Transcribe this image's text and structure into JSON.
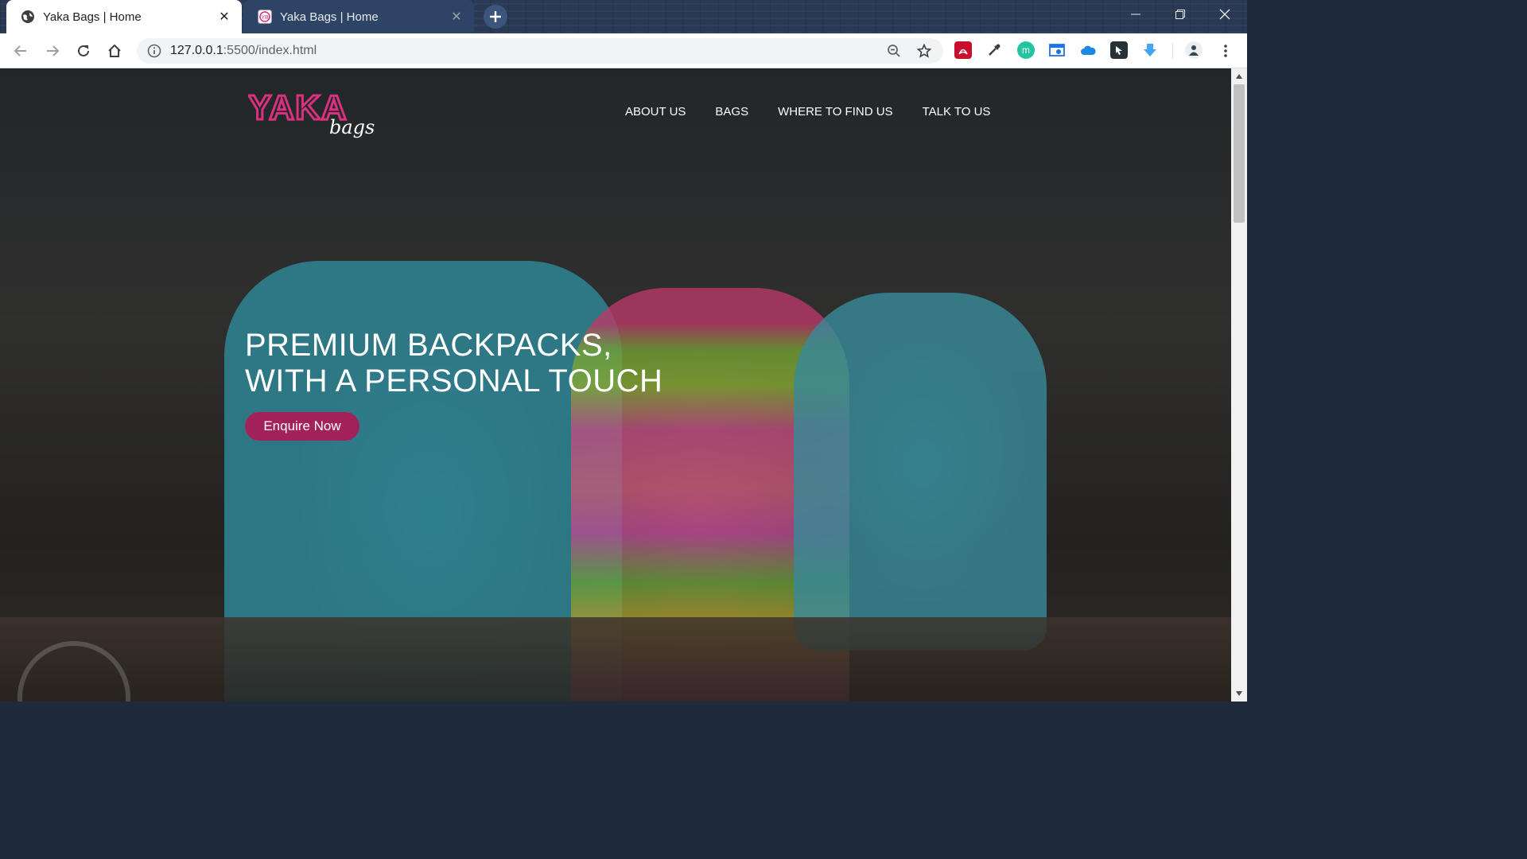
{
  "browser": {
    "tabs": [
      {
        "title": "Yaka Bags | Home",
        "active": true,
        "favicon": "globe-icon"
      },
      {
        "title": "Yaka Bags | Home",
        "active": false,
        "favicon": "yaka-favicon-icon"
      }
    ],
    "new_tab_icon": "plus-icon",
    "window_controls": [
      "minimize-icon",
      "restore-icon",
      "close-icon"
    ],
    "address_bar": {
      "url_host": "127.0.0.1",
      "url_path": ":5500/index.html",
      "info_icon": "info-icon"
    },
    "toolbar_icons": [
      "back-icon",
      "forward-icon",
      "reload-icon",
      "home-icon",
      "zoom-icon",
      "star-icon",
      "menu-dots-icon"
    ],
    "extensions": [
      "pdf-extension-icon",
      "eyedropper-extension-icon",
      "green-circle-extension-icon",
      "screenshot-extension-icon",
      "cloud-extension-icon",
      "dark-cursor-extension-icon",
      "download-arrow-extension-icon",
      "profile-avatar-icon"
    ],
    "colors": {
      "titlebar": "#2a3a55",
      "tab_active": "#ffffff",
      "tab_inactive": "#2e4466"
    }
  },
  "page": {
    "logo": {
      "primary": "YAKA",
      "secondary": "bags",
      "color": "#d9307f"
    },
    "nav": {
      "items": [
        "ABOUT US",
        "BAGS",
        "WHERE TO FIND US",
        "TALK TO US"
      ]
    },
    "hero": {
      "line1": "PREMIUM BACKPACKS,",
      "line2": "WITH A PERSONAL TOUCH",
      "cta": "Enquire Now",
      "cta_color": "#a3215b",
      "background_description_hidden": true
    }
  },
  "scrollbar": {
    "up_icon": "scroll-up-arrow-icon",
    "down_icon": "scroll-down-arrow-icon"
  }
}
